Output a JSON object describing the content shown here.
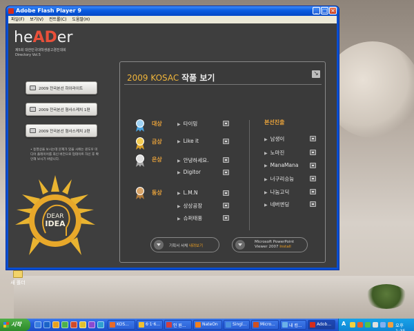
{
  "window": {
    "title": "Adobe Flash Player 9",
    "buttons": {
      "minimize": "_",
      "maximize": "□",
      "close": "×"
    }
  },
  "menu": [
    "파일(F)",
    "보기(V)",
    "컨트롤(C)",
    "도움말(H)"
  ],
  "logo": {
    "part1": "he",
    "part2": "AD",
    "part3": "er",
    "sub1": "제5회 대한민국대학생광고경진대회",
    "sub2": "Directory Vol.5"
  },
  "left_buttons": [
    "2009 전국본선 하이라이트",
    "2009 전국본선 형사스케치 1편",
    "2009 전국본선 형사스케치 2편"
  ],
  "note": "• 동영상을 보시는데 문제가 있을 시에는 윈도우 미디어 플레이어를 최신 버전으로 업데이트 하신 후 확인해 보시기 바랍니다.",
  "emblem": {
    "line1": "DEAR",
    "line2": "IDEA"
  },
  "panel": {
    "title_year": "2009 KOSAC",
    "title_text": "작품 보기",
    "corner_icon": "↘"
  },
  "awards": [
    {
      "label": "대상",
      "entries": [
        "타이밍"
      ],
      "medal": "blue"
    },
    {
      "label": "금상",
      "entries": [
        "Like it"
      ],
      "medal": "gold"
    },
    {
      "label": "은상",
      "entries": [
        "안녕하세요.",
        "Digitor"
      ],
      "medal": "silver"
    },
    {
      "label": "동상",
      "entries": [
        "L.M.N",
        "상상공장",
        "슈퍼태풍"
      ],
      "medal": "bronze"
    }
  ],
  "finalists": {
    "label": "본선진출",
    "entries": [
      "남생이",
      "노마진",
      "ManaMana",
      "너구리승늉",
      "나눔고딕",
      "네버엔딩"
    ]
  },
  "pills": {
    "left": {
      "text": "기획서 서체 ",
      "highlight": "내려보기"
    },
    "right": {
      "line1": "Microsoft PowerPoint",
      "line2": "Viewer 2007 ",
      "highlight": "Install"
    }
  },
  "desktop_icon": "새 폴더",
  "taskbar": {
    "start": "시작",
    "tasks": [
      "KOS...",
      "6·1·6...",
      "인 원...",
      "NateOn",
      "Singl...",
      "Micro...",
      "내 컴...",
      "Adob..."
    ],
    "lang": "A",
    "clock": "오후 1:35"
  },
  "colors": {
    "accent_orange": "#e8a23a",
    "logo_red": "#e9503a",
    "panel_bg": "#3a3a3a",
    "window_blue": "#0a4ed0"
  }
}
